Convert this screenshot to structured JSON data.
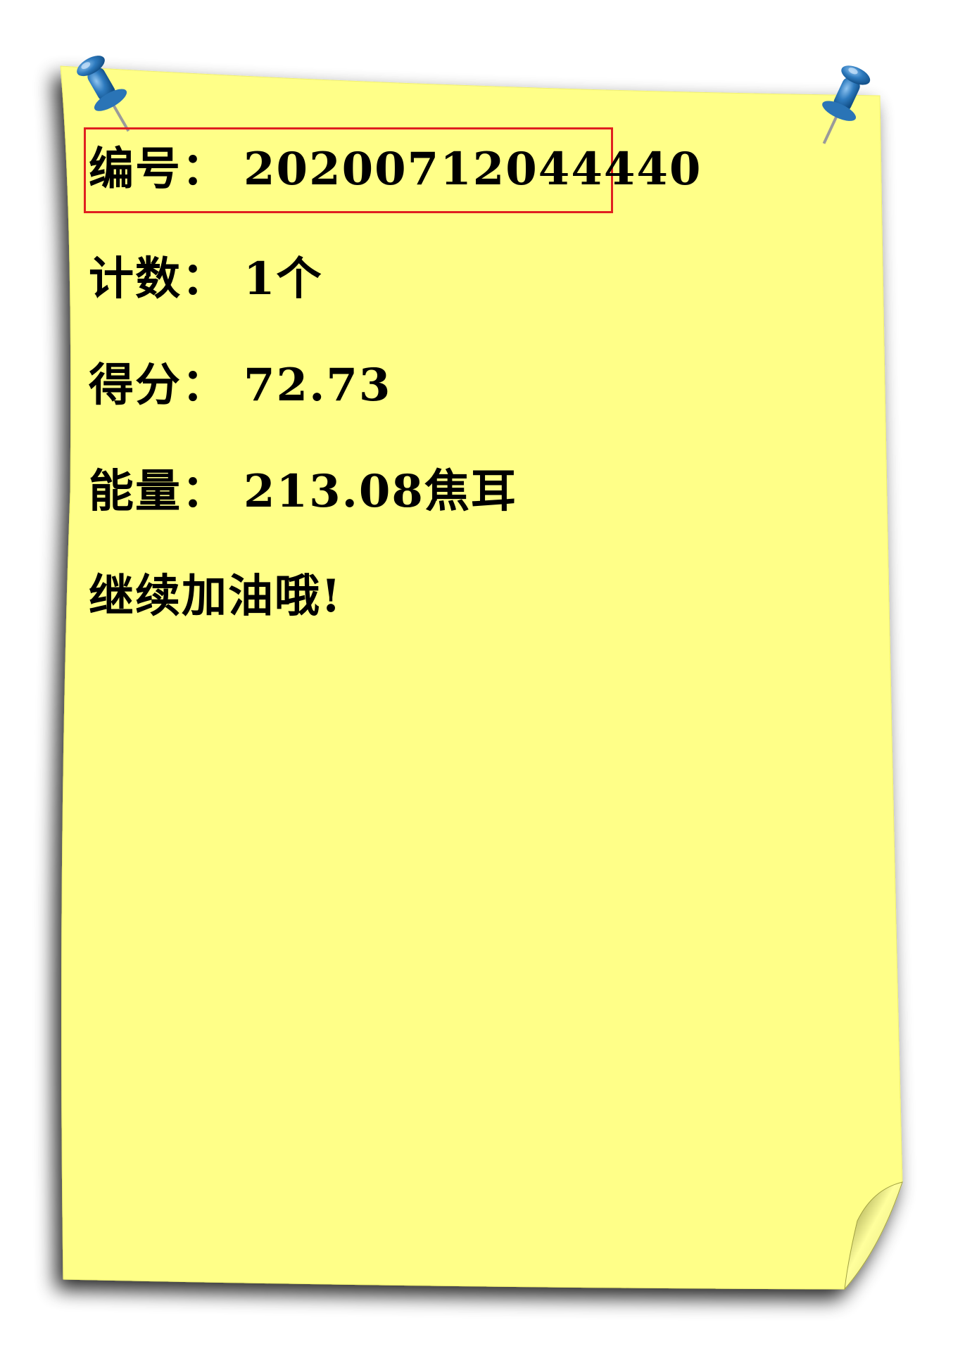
{
  "note": {
    "paper_color": "#ffff88",
    "pin_color": "#2e7bbf",
    "highlight_color": "#e02020",
    "lines": {
      "id_label": "编号：",
      "id_value": "20200712044440",
      "count_label": "计数：",
      "count_value": "1个",
      "score_label": "得分：",
      "score_value": "72.73",
      "energy_label": "能量：",
      "energy_value": "213.08焦耳",
      "cheer": "继续加油哦!"
    },
    "icons": [
      "pushpin-icon",
      "pushpin-icon"
    ]
  }
}
